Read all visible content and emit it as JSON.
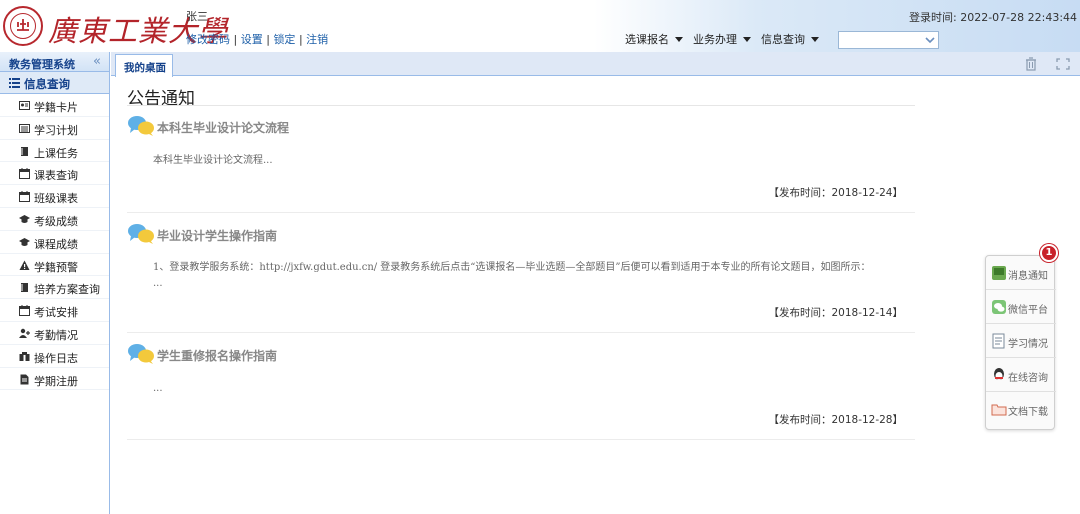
{
  "header": {
    "logo_text": "廣東工業大學",
    "user_name": "张三",
    "user_links": [
      "修改密码",
      "设置",
      "锁定",
      "注销"
    ],
    "link_separator": "|",
    "login_time_label": "登录时间:",
    "login_time_value": "2022-07-28 22:43:44",
    "nav": [
      "选课报名",
      "业务办理",
      "信息查询"
    ],
    "select_value": ""
  },
  "sidebar": {
    "title": "教务管理系统",
    "collapse_icon": "double-chevron-left-icon",
    "section": "信息查询",
    "items": [
      {
        "label": "学籍卡片",
        "icon": "id-card-icon"
      },
      {
        "label": "学习计划",
        "icon": "list-icon"
      },
      {
        "label": "上课任务",
        "icon": "book-icon"
      },
      {
        "label": "课表查询",
        "icon": "calendar-icon"
      },
      {
        "label": "班级课表",
        "icon": "calendar-icon"
      },
      {
        "label": "考级成绩",
        "icon": "graduation-cap-icon"
      },
      {
        "label": "课程成绩",
        "icon": "graduation-cap-icon"
      },
      {
        "label": "学籍预警",
        "icon": "warning-icon"
      },
      {
        "label": "培养方案查询",
        "icon": "book-icon"
      },
      {
        "label": "考试安排",
        "icon": "calendar-icon"
      },
      {
        "label": "考勤情况",
        "icon": "user-add-icon"
      },
      {
        "label": "操作日志",
        "icon": "binoculars-icon"
      },
      {
        "label": "学期注册",
        "icon": "document-icon"
      }
    ]
  },
  "tabs": {
    "active_label": "我的桌面"
  },
  "main": {
    "title": "公告通知",
    "notices": [
      {
        "title": "本科生毕业设计论文流程",
        "body": "本科生毕业设计论文流程...",
        "date": "【发布时间：2018-12-24】"
      },
      {
        "title": "毕业设计学生操作指南",
        "body": "1、登录教学服务系统：http://jxfw.gdut.edu.cn/ 登录教务系统后点击“选课报名—毕业选题—全部题目”后便可以看到适用于本专业的所有论文题目，如图所示： ...",
        "date": "【发布时间：2018-12-14】"
      },
      {
        "title": "学生重修报名操作指南",
        "body": "...",
        "date": "【发布时间：2018-12-28】"
      }
    ]
  },
  "float_panel": {
    "badge": "1",
    "items": [
      {
        "label": "消息通知",
        "icon": "message-icon"
      },
      {
        "label": "微信平台",
        "icon": "wechat-icon"
      },
      {
        "label": "学习情况",
        "icon": "study-icon"
      },
      {
        "label": "在线咨询",
        "icon": "qq-icon"
      },
      {
        "label": "文档下载",
        "icon": "folder-icon"
      }
    ]
  },
  "colors": {
    "brand_red": "#b3242a",
    "nav_blue": "#15428b",
    "border_blue": "#99bbe8"
  }
}
